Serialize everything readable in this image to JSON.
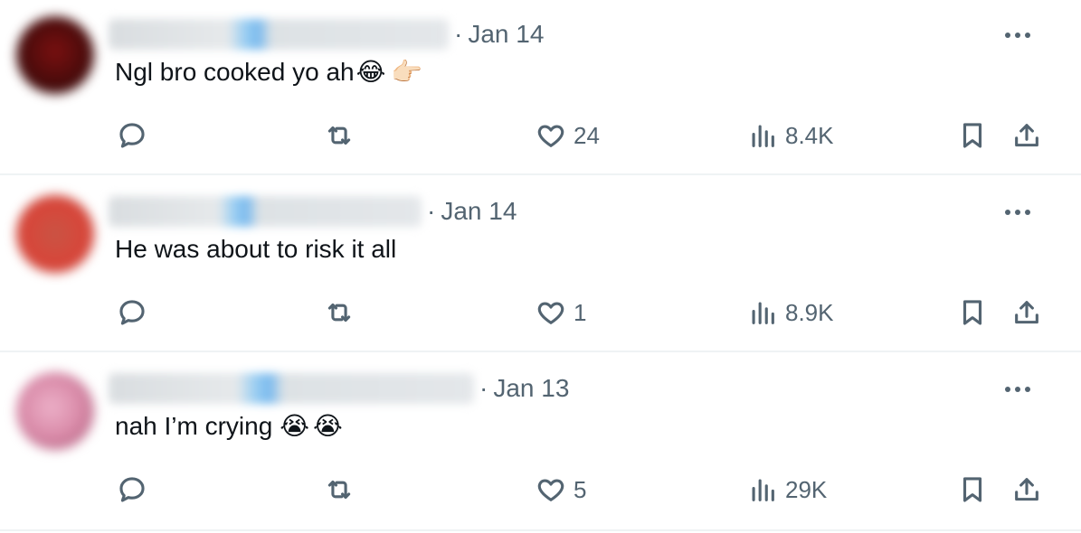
{
  "posts": [
    {
      "date": "Jan 14",
      "text": "Ngl bro cooked yo ah",
      "emojis": [
        "😂",
        "👉🏻"
      ],
      "likes": "24",
      "views": "8.4K",
      "avatar_colors": [
        "#6b0d0d",
        "#2a1010"
      ],
      "redact_width": 376
    },
    {
      "date": "Jan 14",
      "text": "He was about to risk it all",
      "emojis": [],
      "likes": "1",
      "views": "8.9K",
      "avatar_colors": [
        "#d94a3a",
        "#b7332a"
      ],
      "redact_width": 346
    },
    {
      "date": "Jan 13",
      "text": "nah I’m crying",
      "emojis": [
        "😭",
        "😭"
      ],
      "likes": "5",
      "views": "29K",
      "avatar_colors": [
        "#e39ab8",
        "#b05a7c"
      ],
      "redact_width": 404
    }
  ],
  "meta_separator": "·",
  "icons": {
    "reply": "reply-icon",
    "repost": "repost-icon",
    "like": "heart-icon",
    "views": "views-icon",
    "bookmark": "bookmark-icon",
    "share": "share-icon",
    "more": "more-icon"
  },
  "colors": {
    "secondary_text": "#536471",
    "primary_text": "#0f1419",
    "divider": "#eff3f4"
  }
}
